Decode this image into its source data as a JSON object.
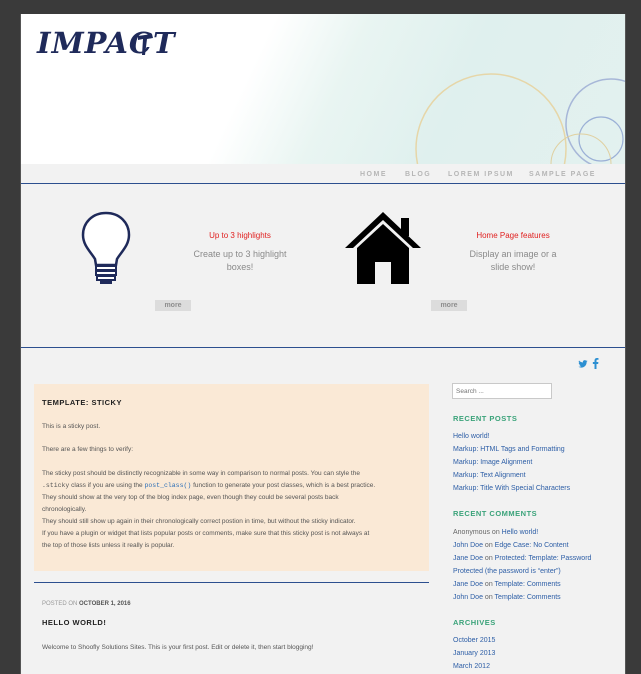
{
  "site": {
    "logo": "IMPACT"
  },
  "nav": {
    "items": [
      "HOME",
      "BLOG",
      "LOREM IPSUM",
      "SAMPLE PAGE"
    ]
  },
  "highlights": [
    {
      "icon": "lightbulb-icon",
      "title": "Up to 3 highlights",
      "desc_line1": "Create up to 3 highlight",
      "desc_line2": "boxes!",
      "more": "more"
    },
    {
      "icon": "house-icon",
      "title": "Home Page features",
      "desc_line1": "Display an image or a",
      "desc_line2": "slide show!",
      "more": "more"
    }
  ],
  "social": {
    "twitter": "twitter-icon",
    "facebook": "facebook-icon"
  },
  "sticky_post": {
    "title": "TEMPLATE: STICKY",
    "p1": "This is a sticky post.",
    "p2": "There are a few things to verify:",
    "p3a": "The sticky post should be distinctly recognizable in some way in comparison to normal posts. You can style the",
    "p3b_code": ".sticky",
    "p3b_mid": " class if you are using the ",
    "p3b_link": "post_class()",
    "p3b_end": " function to generate your post classes, which is a best practice.",
    "p3c": "They should show at the very top of the blog index page, even though they could be several posts back",
    "p3d": "chronologically.",
    "p4": "They should still show up again in their chronologically correct postion in time, but without the sticky indicator.",
    "p5a": "If you have a plugin or widget that lists popular posts or comments, make sure that this sticky post is not always at",
    "p5b": "the top of those lists unless it really is popular."
  },
  "second_post": {
    "posted_on_label": "POSTED ON",
    "date": "OCTOBER 1, 2016",
    "title": "HELLO WORLD!",
    "excerpt": "Welcome to Shoofly Solutions Sites. This is your first post. Edit or delete it, then start blogging!"
  },
  "sidebar": {
    "search_placeholder": "Search ...",
    "recent_posts_heading": "RECENT POSTS",
    "recent_posts": [
      "Hello world!",
      "Markup: HTML Tags and Formatting",
      "Markup: Image Alignment",
      "Markup: Text Alignment",
      "Markup: Title With Special Characters"
    ],
    "recent_comments_heading": "RECENT COMMENTS",
    "on_word": "on",
    "comments": [
      {
        "author": "Anonymous",
        "post": "Hello world!"
      },
      {
        "author": "John Doe",
        "post": "Edge Case: No Content"
      },
      {
        "author": "Jane Doe",
        "post": "Protected: Template: Password"
      },
      {
        "author": "",
        "post": "Protected (the password is “enter”)"
      },
      {
        "author": "Jane Doe",
        "post": "Template: Comments"
      },
      {
        "author": "John Doe",
        "post": "Template: Comments"
      }
    ],
    "archives_heading": "ARCHIVES",
    "archives": [
      "October 2015",
      "January 2013",
      "March 2012"
    ]
  },
  "colors": {
    "accent_blue": "#2c4f8f",
    "highlight_red": "#e02020",
    "sidebar_green": "#3ba37a",
    "sticky_bg": "#fae9d6"
  }
}
